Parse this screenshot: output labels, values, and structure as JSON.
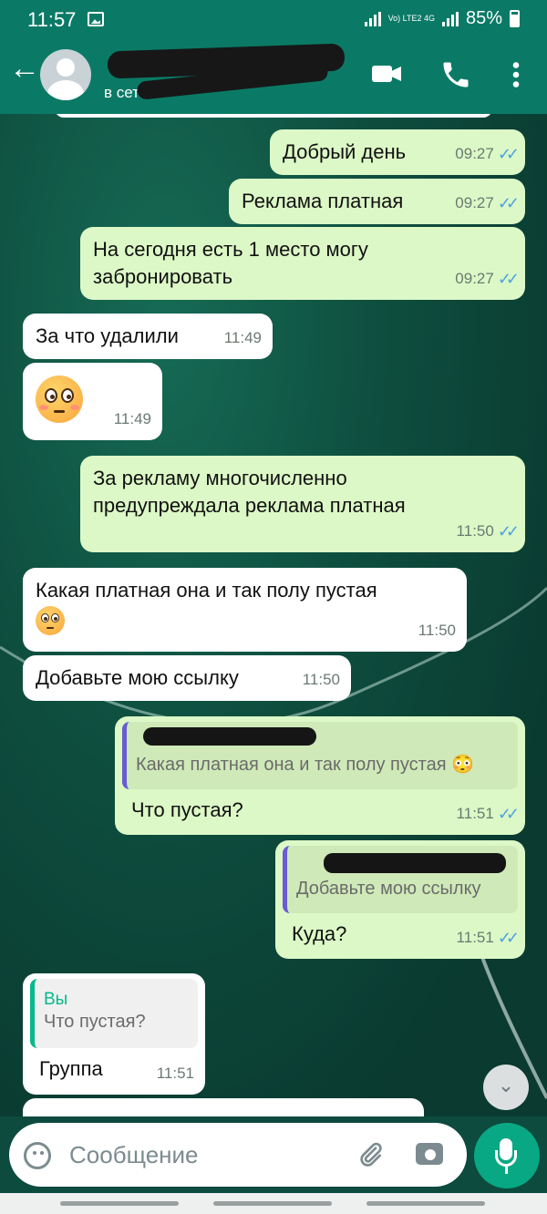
{
  "status": {
    "time": "11:57",
    "network": "Vo) LTE2 4G",
    "battery": "85%"
  },
  "header": {
    "contact_status": "в сети"
  },
  "messages": [
    {
      "dir": "out",
      "text": "Добрый день",
      "time": "09:27"
    },
    {
      "dir": "out",
      "text": "Реклама платная",
      "time": "09:27"
    },
    {
      "dir": "out",
      "text": "На сегодня есть 1 место могу забронировать",
      "time": "09:27"
    },
    {
      "dir": "in",
      "text": "За что удалили",
      "time": "11:49"
    },
    {
      "dir": "in",
      "text": "",
      "emoji": "flushed-face-emoji",
      "time": "11:49"
    },
    {
      "dir": "out",
      "text": "За рекламу многочисленно предупреждала реклама платная",
      "time": "11:50"
    },
    {
      "dir": "in",
      "text": "Какая платная она и так полу пустая",
      "time": "11:50"
    },
    {
      "dir": "in",
      "text": "Добавьте мою ссылку",
      "time": "11:50"
    },
    {
      "dir": "out",
      "reply_to": "Какая платная она и так полу пустая",
      "text": "Что пустая?",
      "time": "11:51"
    },
    {
      "dir": "out",
      "reply_to": "Добавьте мою ссылку",
      "text": "Куда?",
      "time": "11:51"
    },
    {
      "dir": "in",
      "reply_author": "Вы",
      "reply_to": "Что пустая?",
      "text": "Группа",
      "time": "11:51"
    }
  ],
  "composer": {
    "placeholder": "Сообщение"
  },
  "colors": {
    "header": "#0a7a66",
    "outgoing": "#dcf8c6",
    "incoming": "#ffffff",
    "accent": "#08a884",
    "ticks": "#4fa3e3"
  },
  "icons": [
    "back-arrow-icon",
    "video-call-icon",
    "phone-icon",
    "more-options-icon",
    "emoji-icon",
    "attach-icon",
    "camera-icon",
    "mic-icon",
    "scroll-down-icon"
  ]
}
